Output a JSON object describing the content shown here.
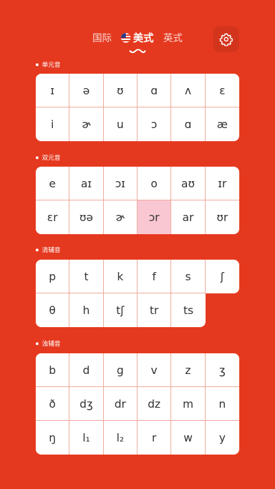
{
  "header": {
    "tabs": [
      {
        "label": "国际",
        "active": false
      },
      {
        "label": "美式",
        "active": true
      },
      {
        "label": "英式",
        "active": false
      }
    ],
    "settings_icon": "gear-icon"
  },
  "sections": [
    {
      "title": "单元音",
      "cells": [
        "ɪ",
        "ə",
        "ʊ",
        "ɑ",
        "ʌ",
        "ɛ",
        "i",
        "ɚ",
        "u",
        "ɔ",
        "ɑ",
        "æ"
      ]
    },
    {
      "title": "双元音",
      "cells": [
        "e",
        "aɪ",
        "ɔɪ",
        "o",
        "aʊ",
        "ɪr",
        "ɛr",
        "ʊə",
        "ɚ",
        "ɔr",
        "ar",
        "ʊr"
      ],
      "highlighted": "ɔr"
    },
    {
      "title": "清辅音",
      "cells": [
        "p",
        "t",
        "k",
        "f",
        "s",
        "ʃ",
        "θ",
        "h",
        "tʃ",
        "tr",
        "ts"
      ]
    },
    {
      "title": "浊辅音",
      "cells": [
        "b",
        "d",
        "g",
        "v",
        "z",
        "ʒ",
        "ð",
        "dʒ",
        "dr",
        "dz",
        "m",
        "n",
        "ŋ",
        "l₁",
        "l₂",
        "r",
        "w",
        "y"
      ]
    }
  ],
  "colors": {
    "background": "#e5391f",
    "highlight": "#f9c7d2"
  }
}
